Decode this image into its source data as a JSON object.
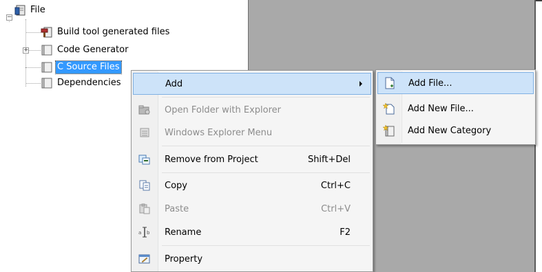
{
  "tree": {
    "items": [
      {
        "label": "File",
        "icon": "project-file-icon",
        "expander": "−"
      },
      {
        "label": "Build tool generated files",
        "icon": "build-files-icon"
      },
      {
        "label": "Code Generator",
        "icon": "folder-icon",
        "expander": "+"
      },
      {
        "label": "C Source Files",
        "icon": "folder-icon",
        "selected": true
      },
      {
        "label": "Dependencies",
        "icon": "folder-icon"
      }
    ]
  },
  "context_menu": {
    "items": [
      {
        "label": "Add",
        "icon": "",
        "shortcut": "",
        "state": "highlighted",
        "submenu": true
      },
      {
        "label": "Open Folder with Explorer",
        "icon": "folder-explorer-icon",
        "shortcut": "",
        "state": "disabled"
      },
      {
        "label": "Windows Explorer Menu",
        "icon": "explorer-menu-icon",
        "shortcut": "",
        "state": "disabled"
      },
      {
        "label": "Remove from Project",
        "icon": "remove-icon",
        "shortcut": "Shift+Del",
        "state": "enabled"
      },
      {
        "label": "Copy",
        "icon": "copy-icon",
        "shortcut": "Ctrl+C",
        "state": "enabled"
      },
      {
        "label": "Paste",
        "icon": "paste-icon",
        "shortcut": "Ctrl+V",
        "state": "disabled"
      },
      {
        "label": "Rename",
        "icon": "rename-icon",
        "shortcut": "F2",
        "state": "enabled"
      },
      {
        "label": "Property",
        "icon": "property-icon",
        "shortcut": "",
        "state": "enabled"
      }
    ]
  },
  "submenu": {
    "items": [
      {
        "label": "Add File...",
        "icon": "add-file-icon",
        "state": "highlighted"
      },
      {
        "label": "Add New File...",
        "icon": "add-new-file-icon",
        "state": "enabled"
      },
      {
        "label": "Add New Category",
        "icon": "add-category-icon",
        "state": "enabled"
      }
    ]
  },
  "colors": {
    "selection": "#3399ff",
    "menu_highlight": "#cde3f9",
    "menu_highlight_border": "#7fb0e3",
    "background_gray": "#a9a9a9"
  }
}
